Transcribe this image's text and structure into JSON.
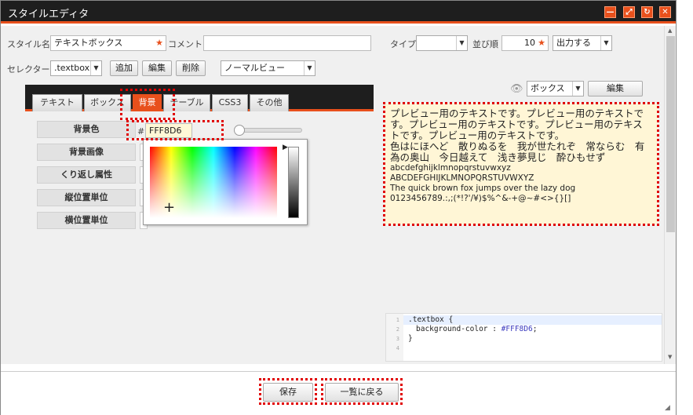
{
  "window": {
    "title": "スタイルエディタ",
    "controls": [
      "minimize",
      "maximize",
      "reload",
      "close"
    ]
  },
  "form": {
    "style_name_label": "スタイル名",
    "style_name_value": "テキストボックス",
    "comment_label": "コメント",
    "comment_value": "",
    "type_label": "タイプ",
    "type_value": "",
    "order_label": "並び順",
    "order_value": "10",
    "output_value": "出力する",
    "required_mark": "★",
    "selector_label": "セレクター",
    "selector_value": ".textbox",
    "add_label": "追加",
    "edit_label": "編集",
    "delete_label": "削除",
    "view_value": "ノーマルビュー"
  },
  "tabs": [
    {
      "label": "テキスト"
    },
    {
      "label": "ボックス"
    },
    {
      "label": "背景",
      "active": true
    },
    {
      "label": "テーブル"
    },
    {
      "label": "CSS3"
    },
    {
      "label": "その他"
    }
  ],
  "properties": [
    {
      "label": "背景色"
    },
    {
      "label": "背景画像"
    },
    {
      "label": "くり返し属性"
    },
    {
      "label": "縦位置単位"
    },
    {
      "label": "横位置単位"
    }
  ],
  "color": {
    "prefix": "#",
    "value": "FFF8D6",
    "swatch": "#fff8d6"
  },
  "preview_controls": {
    "eye_icon": "eye-icon",
    "select_value": "ボックス",
    "edit_label": "編集"
  },
  "preview": {
    "jp_line": "プレビュー用のテキストです。プレビュー用のテキストです。プレビュー用のテキストです。プレビュー用のテキストです。プレビュー用のテキストです。",
    "iroha": "色はにほへど　散りぬるを　我が世たれぞ　常ならむ　有為の奥山　今日越えて　浅き夢見じ　酔ひもせず",
    "lower": "abcdefghijklmnopqrstuvwxyz",
    "upper": "ABCDEFGHIJKLMNOPQRSTUVWXYZ",
    "pangram": "The quick brown fox jumps over the lazy dog",
    "symbols": "0123456789.:,;(*!?'/¥)$%^&-+@~#<>{}[]"
  },
  "code": {
    "line_numbers": [
      "1",
      "2",
      "3",
      "4"
    ],
    "line1": ".textbox {",
    "line2_prop": "background-color : ",
    "line2_val": "#FFF8D6",
    "line2_end": ";",
    "line3": "}"
  },
  "footer": {
    "save_label": "保存",
    "back_label": "一覧に戻る"
  },
  "colors": {
    "accent": "#e8501c",
    "titlebar": "#1e1e1e",
    "highlight": "#e00000"
  }
}
